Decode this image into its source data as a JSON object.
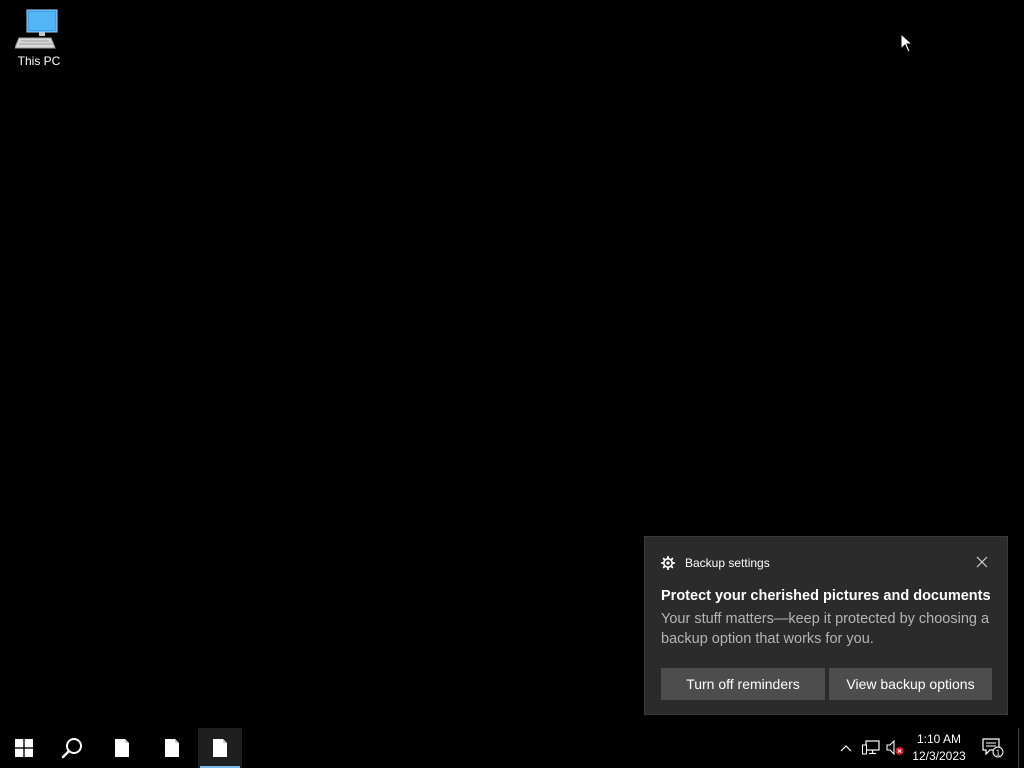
{
  "desktop": {
    "icons": [
      {
        "label": "This PC",
        "icon": "this-pc-icon"
      }
    ]
  },
  "toast": {
    "app_name": "Backup settings",
    "app_icon": "gear-icon",
    "title": "Protect your cherished pictures and documents",
    "body": "Your stuff matters—keep it protected by choosing a backup option that works for you.",
    "buttons": {
      "turn_off": "Turn off reminders",
      "view": "View backup options"
    },
    "close_icon": "close-icon"
  },
  "taskbar": {
    "start_icon": "windows-start-icon",
    "search_icon": "search-icon",
    "pinned_apps": [
      "document-icon",
      "document-icon",
      "document-icon"
    ],
    "tray": {
      "chevron_icon": "chevron-up-icon",
      "network_icon": "network-icon",
      "volume_icon": "volume-muted-icon",
      "time": "1:10 AM",
      "date": "12/3/2023",
      "notification_count": "1"
    }
  },
  "colors": {
    "desktop_bg": "#000000",
    "toast_bg": "#2b2b2b",
    "button_bg": "#4d4d4d",
    "accent": "#76b9ed"
  }
}
